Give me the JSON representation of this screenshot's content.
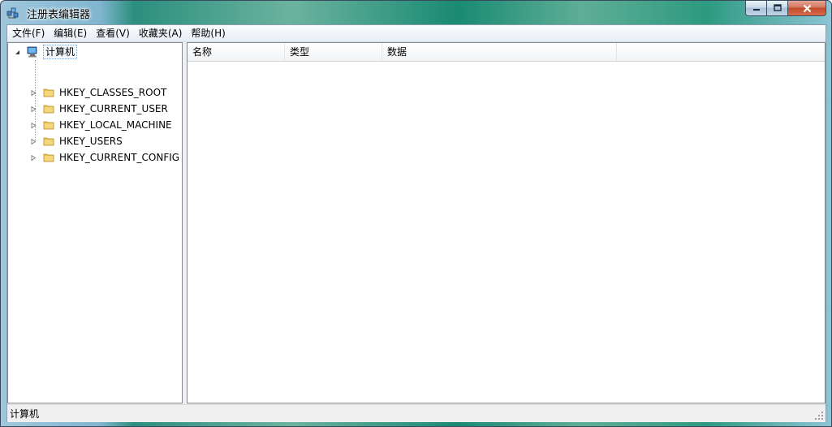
{
  "window": {
    "title": "注册表编辑器"
  },
  "menu": [
    {
      "label": "文件(F)"
    },
    {
      "label": "编辑(E)"
    },
    {
      "label": "查看(V)"
    },
    {
      "label": "收藏夹(A)"
    },
    {
      "label": "帮助(H)"
    }
  ],
  "tree": {
    "root": {
      "label": "计算机",
      "expander": "expanded-arrow",
      "icon": "computer-icon"
    },
    "keys": [
      {
        "label": "HKEY_CLASSES_ROOT",
        "icon": "folder-icon"
      },
      {
        "label": "HKEY_CURRENT_USER",
        "icon": "folder-icon"
      },
      {
        "label": "HKEY_LOCAL_MACHINE",
        "icon": "folder-icon"
      },
      {
        "label": "HKEY_USERS",
        "icon": "folder-icon"
      },
      {
        "label": "HKEY_CURRENT_CONFIG",
        "icon": "folder-icon"
      }
    ]
  },
  "list": {
    "columns": [
      {
        "label": "名称"
      },
      {
        "label": "类型"
      },
      {
        "label": "数据"
      }
    ],
    "rows": []
  },
  "status": {
    "path": "计算机"
  },
  "colors": {
    "selection_border": "#7da2ce",
    "close_button": "#c24a2c",
    "folder": "#e8c15a"
  }
}
